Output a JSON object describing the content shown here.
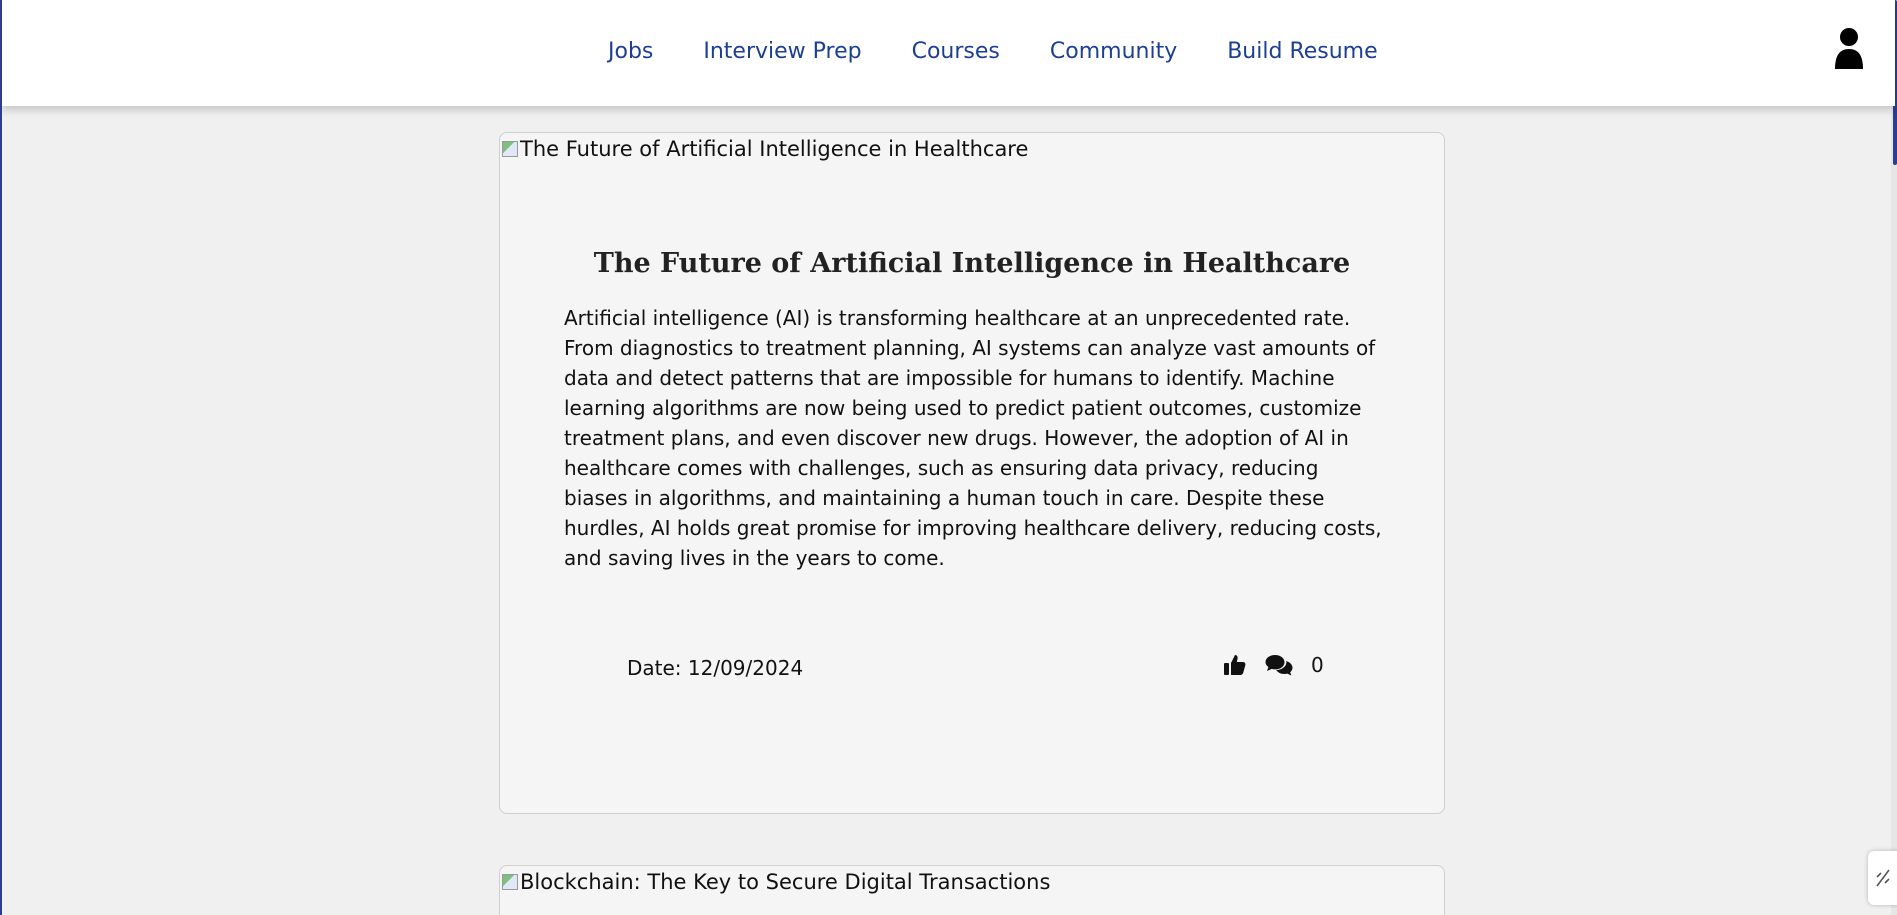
{
  "nav": {
    "links": [
      {
        "label": "Jobs"
      },
      {
        "label": "Interview Prep"
      },
      {
        "label": "Courses"
      },
      {
        "label": "Community"
      },
      {
        "label": "Build Resume"
      }
    ],
    "profile_icon": "user-icon",
    "link_color": "#1c3f94"
  },
  "articles": [
    {
      "image_alt": "The Future of Artificial Intelligence in Healthcare",
      "title": "The Future of Artificial Intelligence in Healthcare",
      "body": "Artificial intelligence (AI) is transforming healthcare at an unprecedented rate. From diagnostics to treatment planning, AI systems can analyze vast amounts of data and detect patterns that are impossible for humans to identify. Machine learning algorithms are now being used to predict patient outcomes, customize treatment plans, and even discover new drugs. However, the adoption of AI in healthcare comes with challenges, such as ensuring data privacy, reducing biases in algorithms, and maintaining a human touch in care. Despite these hurdles, AI holds great promise for improving healthcare delivery, reducing costs, and saving lives in the years to come.",
      "date": "Date: 12/09/2024",
      "like_icon": "thumbs-up-icon",
      "comment_icon": "comments-icon",
      "comment_count": "0"
    },
    {
      "image_alt": "Blockchain: The Key to Secure Digital Transactions"
    }
  ],
  "colors": {
    "page_background": "#f0f0f0",
    "card_background": "#f5f5f5",
    "accent": "#2a3f8f"
  }
}
